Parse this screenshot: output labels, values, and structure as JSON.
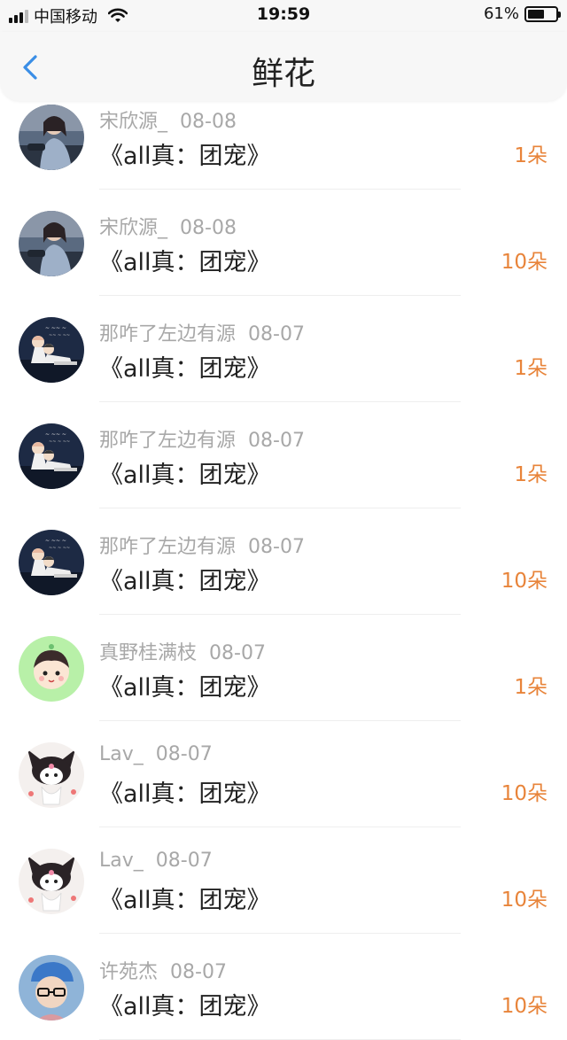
{
  "status_bar": {
    "carrier": "中国移动",
    "time": "19:59",
    "battery_percent": "61%",
    "battery_level": 0.61
  },
  "nav": {
    "back_icon": "chevron-left-icon",
    "title": "鲜花"
  },
  "colors": {
    "accent_back": "#3a8ee6",
    "amount": "#e8843a",
    "meta": "#a8a8a8"
  },
  "items": [
    {
      "user": "宋欣源_",
      "date": "08-08",
      "work": "《all真：团宠》",
      "amount": "1朵",
      "avatar": "girl-photo"
    },
    {
      "user": "宋欣源_",
      "date": "08-08",
      "work": "《all真：团宠》",
      "amount": "10朵",
      "avatar": "girl-photo"
    },
    {
      "user": "那咋了左边有源",
      "date": "08-07",
      "work": "《all真：团宠》",
      "amount": "1朵",
      "avatar": "anime-couple"
    },
    {
      "user": "那咋了左边有源",
      "date": "08-07",
      "work": "《all真：团宠》",
      "amount": "1朵",
      "avatar": "anime-couple"
    },
    {
      "user": "那咋了左边有源",
      "date": "08-07",
      "work": "《all真：团宠》",
      "amount": "10朵",
      "avatar": "anime-couple"
    },
    {
      "user": "真野桂满枝",
      "date": "08-07",
      "work": "《all真：团宠》",
      "amount": "1朵",
      "avatar": "cartoon-boy"
    },
    {
      "user": "Lav_",
      "date": "08-07",
      "work": "《all真：团宠》",
      "amount": "10朵",
      "avatar": "kuromi"
    },
    {
      "user": "Lav_",
      "date": "08-07",
      "work": "《all真：团宠》",
      "amount": "10朵",
      "avatar": "kuromi"
    },
    {
      "user": "许苑杰",
      "date": "08-07",
      "work": "《all真：团宠》",
      "amount": "10朵",
      "avatar": "boy-photo"
    }
  ]
}
